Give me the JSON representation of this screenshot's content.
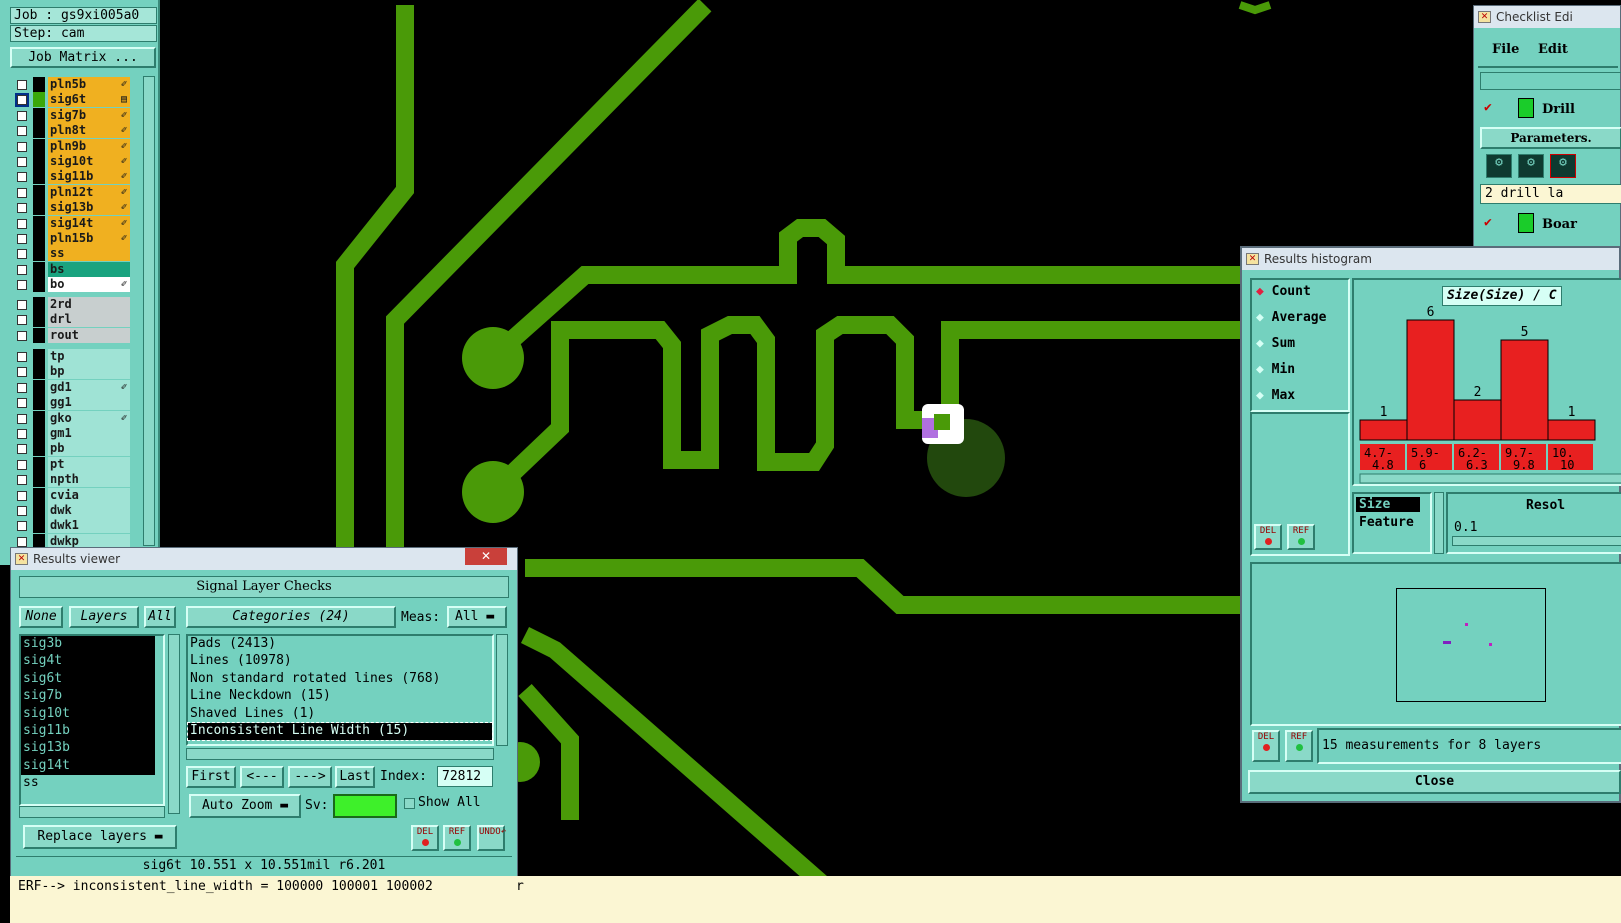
{
  "job": {
    "job_label": "Job : gs9xi005a0",
    "step_label": "Step: cam",
    "matrix_button": "Job Matrix ..."
  },
  "layers": [
    {
      "name": "pln5b",
      "color": "#f0b020",
      "mark": "✐",
      "selected": false
    },
    {
      "name": "sig6t",
      "color": "#f0b020",
      "mark": "▤",
      "selected": true
    },
    {
      "name": "sig7b",
      "color": "#f0b020",
      "mark": "✐",
      "selected": false
    },
    {
      "name": "pln8t",
      "color": "#f0b020",
      "mark": "✐",
      "selected": false
    },
    {
      "name": "pln9b",
      "color": "#f0b020",
      "mark": "✐",
      "selected": false
    },
    {
      "name": "sig10t",
      "color": "#f0b020",
      "mark": "✐",
      "selected": false
    },
    {
      "name": "sig11b",
      "color": "#f0b020",
      "mark": "✐",
      "selected": false
    },
    {
      "name": "pln12t",
      "color": "#f0b020",
      "mark": "✐",
      "selected": false
    },
    {
      "name": "sig13b",
      "color": "#f0b020",
      "mark": "✐",
      "selected": false
    },
    {
      "name": "sig14t",
      "color": "#f0b020",
      "mark": "✐",
      "selected": false
    },
    {
      "name": "pln15b",
      "color": "#f0b020",
      "mark": "✐",
      "selected": false
    },
    {
      "name": "ss",
      "color": "#f0b020",
      "mark": "",
      "selected": false
    },
    {
      "name": "bs",
      "color": "#1aa37f",
      "mark": "",
      "selected": false
    },
    {
      "name": "bo",
      "color": "#ffffff",
      "mark": "✐",
      "selected": false
    }
  ],
  "drill_layers": [
    {
      "name": "2rd"
    },
    {
      "name": "drl"
    },
    {
      "name": "rout"
    }
  ],
  "misc_layers": [
    {
      "name": "tp",
      "mark": ""
    },
    {
      "name": "bp",
      "mark": ""
    },
    {
      "name": "gd1",
      "mark": "✐"
    },
    {
      "name": "gg1",
      "mark": ""
    },
    {
      "name": "gko",
      "mark": "✐"
    },
    {
      "name": "gm1",
      "mark": ""
    },
    {
      "name": "pb",
      "mark": ""
    },
    {
      "name": "pt",
      "mark": ""
    },
    {
      "name": "npth",
      "mark": ""
    },
    {
      "name": "cvia",
      "mark": ""
    },
    {
      "name": "dwk",
      "mark": ""
    },
    {
      "name": "dwk1",
      "mark": ""
    },
    {
      "name": "dwkp",
      "mark": ""
    }
  ],
  "results_viewer": {
    "title": "Results viewer",
    "header": "Signal Layer Checks",
    "none_btn": "None",
    "layers_btn": "Layers",
    "all_btn": "All",
    "categories_btn": "Categories (24)",
    "meas_label": "Meas:",
    "meas_value": "All",
    "layer_list": [
      "sig3b",
      "sig4t",
      "sig6t",
      "sig7b",
      "sig10t",
      "sig11b",
      "sig13b",
      "sig14t",
      "ss"
    ],
    "categories": [
      "Pads (2413)",
      "Lines (10978)",
      "Non standard rotated lines (768)",
      "Line Neckdown (15)",
      "Shaved Lines (1)",
      "Inconsistent Line Width (15)"
    ],
    "first_btn": "First",
    "prev_btn": "<---",
    "next_btn": "--->",
    "last_btn": "Last",
    "index_label": "Index:",
    "index_value": "72812",
    "autozoom_btn": "Auto Zoom",
    "sv_label": "Sv:",
    "show_all": "Show All",
    "replace_btn": "Replace layers",
    "del": "DEL",
    "ref": "REF",
    "undo": "UNDO",
    "status": "sig6t 10.551 x 10.551mil  r6.201"
  },
  "erf_line": "ERF--> inconsistent_line_width = 100000 100001 100002",
  "cursor_char": "r",
  "histogram": {
    "title": "Results histogram",
    "modes": [
      "Count",
      "Average",
      "Sum",
      "Min",
      "Max"
    ],
    "selected_mode": "Count",
    "chart_title": "Size(Size) / C",
    "size_label": "Size",
    "feature_label": "Feature",
    "resolution_label": "Resol",
    "resolution_value": "0.1",
    "summary": "15 measurements for 8 layers",
    "close": "Close",
    "del": "DEL",
    "ref": "REF"
  },
  "chart_data": {
    "type": "bar",
    "categories": [
      "4.7-4.8",
      "5.9-6",
      "6.2-6.3",
      "9.7-9.8",
      "10."
    ],
    "values": [
      1,
      6,
      2,
      5,
      1
    ],
    "category_labels_top": [
      "4.7-",
      "5.9-",
      "6.2-",
      "9.7-",
      "10."
    ],
    "category_labels_bottom": [
      "4.8",
      "6",
      "6.3",
      "9.8",
      "10"
    ],
    "bar_color": "#e82020",
    "ylim": [
      0,
      6
    ],
    "title": "Size(Size) / C"
  },
  "checklist": {
    "title": "Checklist Edi",
    "file": "File",
    "edit": "Edit",
    "item1": "Drill",
    "params": "Parameters.",
    "drill_text": "2 drill la",
    "item2": "Boar"
  }
}
